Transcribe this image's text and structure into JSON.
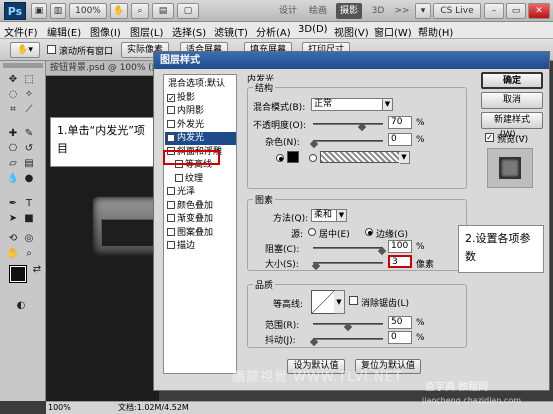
{
  "appbar": {
    "logo": "Ps",
    "zoom": "100%",
    "workspaces": [
      "设计",
      "绘画",
      "摄影",
      "3D"
    ],
    "more": ">>",
    "cs_live": "CS Live"
  },
  "menu": [
    "文件(F)",
    "编辑(E)",
    "图像(I)",
    "图层(L)",
    "选择(S)",
    "滤镜(T)",
    "分析(A)",
    "3D(D)",
    "视图(V)",
    "窗口(W)",
    "帮助(H)"
  ],
  "options": {
    "checkbox": "滚动所有窗口",
    "btn1": "实际像素",
    "btn2": "适合屏幕",
    "btn3": "填充屏幕",
    "btn4": "打印尺寸"
  },
  "document": {
    "tab": "按钮背景.psd @ 100% (内",
    "zoom": "100%",
    "docsize": "文档:1.02M/4.52M"
  },
  "dialog": {
    "title": "图层样式",
    "list_header": "样式",
    "list": [
      {
        "label": "混合选项:默认",
        "check": false,
        "hasbox": false
      },
      {
        "label": "投影",
        "check": true,
        "hasbox": true
      },
      {
        "label": "内阴影",
        "check": false,
        "hasbox": true
      },
      {
        "label": "外发光",
        "check": false,
        "hasbox": true
      },
      {
        "label": "内发光",
        "check": true,
        "hasbox": true
      },
      {
        "label": "斜面和浮雕",
        "check": false,
        "hasbox": true
      },
      {
        "label": "等高线",
        "check": false,
        "hasbox": true
      },
      {
        "label": "纹理",
        "check": false,
        "hasbox": true
      },
      {
        "label": "光泽",
        "check": false,
        "hasbox": true
      },
      {
        "label": "颜色叠加",
        "check": false,
        "hasbox": true
      },
      {
        "label": "渐变叠加",
        "check": false,
        "hasbox": true
      },
      {
        "label": "图案叠加",
        "check": false,
        "hasbox": true
      },
      {
        "label": "描边",
        "check": false,
        "hasbox": true
      }
    ],
    "section": "内发光",
    "structure": {
      "label": "结构",
      "blend_mode_label": "混合模式(B):",
      "blend_mode": "正常",
      "opacity_label": "不透明度(O):",
      "opacity": "70",
      "noise_label": "杂色(N):",
      "noise": "0",
      "pct": "%"
    },
    "elements": {
      "label": "图素",
      "method_label": "方法(Q):",
      "method": "柔和",
      "source_label": "源:",
      "center": "居中(E)",
      "edge": "边缘(G)",
      "choke_label": "阻塞(C):",
      "choke": "100",
      "size_label": "大小(S):",
      "size": "3",
      "px": "像素",
      "pct": "%"
    },
    "quality": {
      "label": "品质",
      "contour_label": "等高线:",
      "antialias": "消除锯齿(L)",
      "range_label": "范围(R):",
      "range": "50",
      "jitter_label": "抖动(J):",
      "jitter": "0",
      "pct": "%"
    },
    "default_btn": "设为默认值",
    "reset_btn": "复位为默认值",
    "ok": "确定",
    "cancel": "取消",
    "new_style": "新建样式(W)...",
    "preview": "预览(V)"
  },
  "callouts": {
    "c1": "1.单击“内发光”项目",
    "c2": "2.设置各项参数"
  },
  "watermark": {
    "w1": "鵬龍視覺 WWW.TLVI.NET",
    "w2": "查字典 教程网",
    "w3": "jiaocheng.chazidian.com"
  }
}
